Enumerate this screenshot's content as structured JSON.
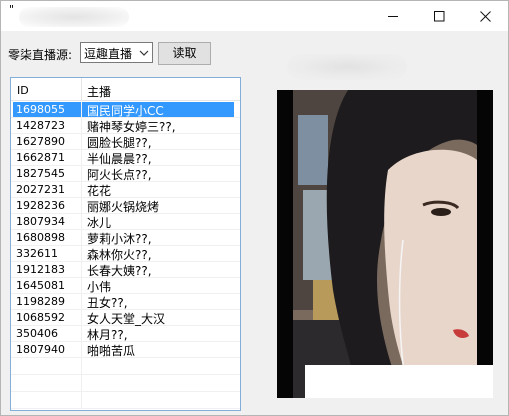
{
  "window": {
    "title": "\"",
    "minimize_label": "minimize",
    "maximize_label": "maximize",
    "close_label": "close"
  },
  "toolbar": {
    "source_label": "零柒直播源:",
    "source_value": "逗趣直播",
    "read_button": "读取"
  },
  "list": {
    "columns": [
      "ID",
      "主播"
    ],
    "rows": [
      {
        "id": "1698055",
        "name": "国民同学小CC",
        "selected": true
      },
      {
        "id": "1428723",
        "name": "赌神琴女婷三??,"
      },
      {
        "id": "1627890",
        "name": "圆脸长腿??,"
      },
      {
        "id": "1662871",
        "name": "半仙晨晨??,"
      },
      {
        "id": "1827545",
        "name": "阿火长点??,"
      },
      {
        "id": "2027231",
        "name": "花花"
      },
      {
        "id": "1928236",
        "name": "丽娜火锅烧烤"
      },
      {
        "id": "1807934",
        "name": "冰儿"
      },
      {
        "id": "1680898",
        "name": "萝莉小沐??,"
      },
      {
        "id": "332611",
        "name": "森林你火??,"
      },
      {
        "id": "1912183",
        "name": "长春大姨??,"
      },
      {
        "id": "1645081",
        "name": "小伟"
      },
      {
        "id": "1198289",
        "name": "丑女??,"
      },
      {
        "id": "1068592",
        "name": "女人天堂_大汉"
      },
      {
        "id": "350406",
        "name": "林月??,"
      },
      {
        "id": "1807940",
        "name": "啪啪苦瓜"
      }
    ]
  },
  "colors": {
    "selection": "#3399ff",
    "list_border": "#82aed9",
    "window_bg": "#f0f0f0"
  }
}
